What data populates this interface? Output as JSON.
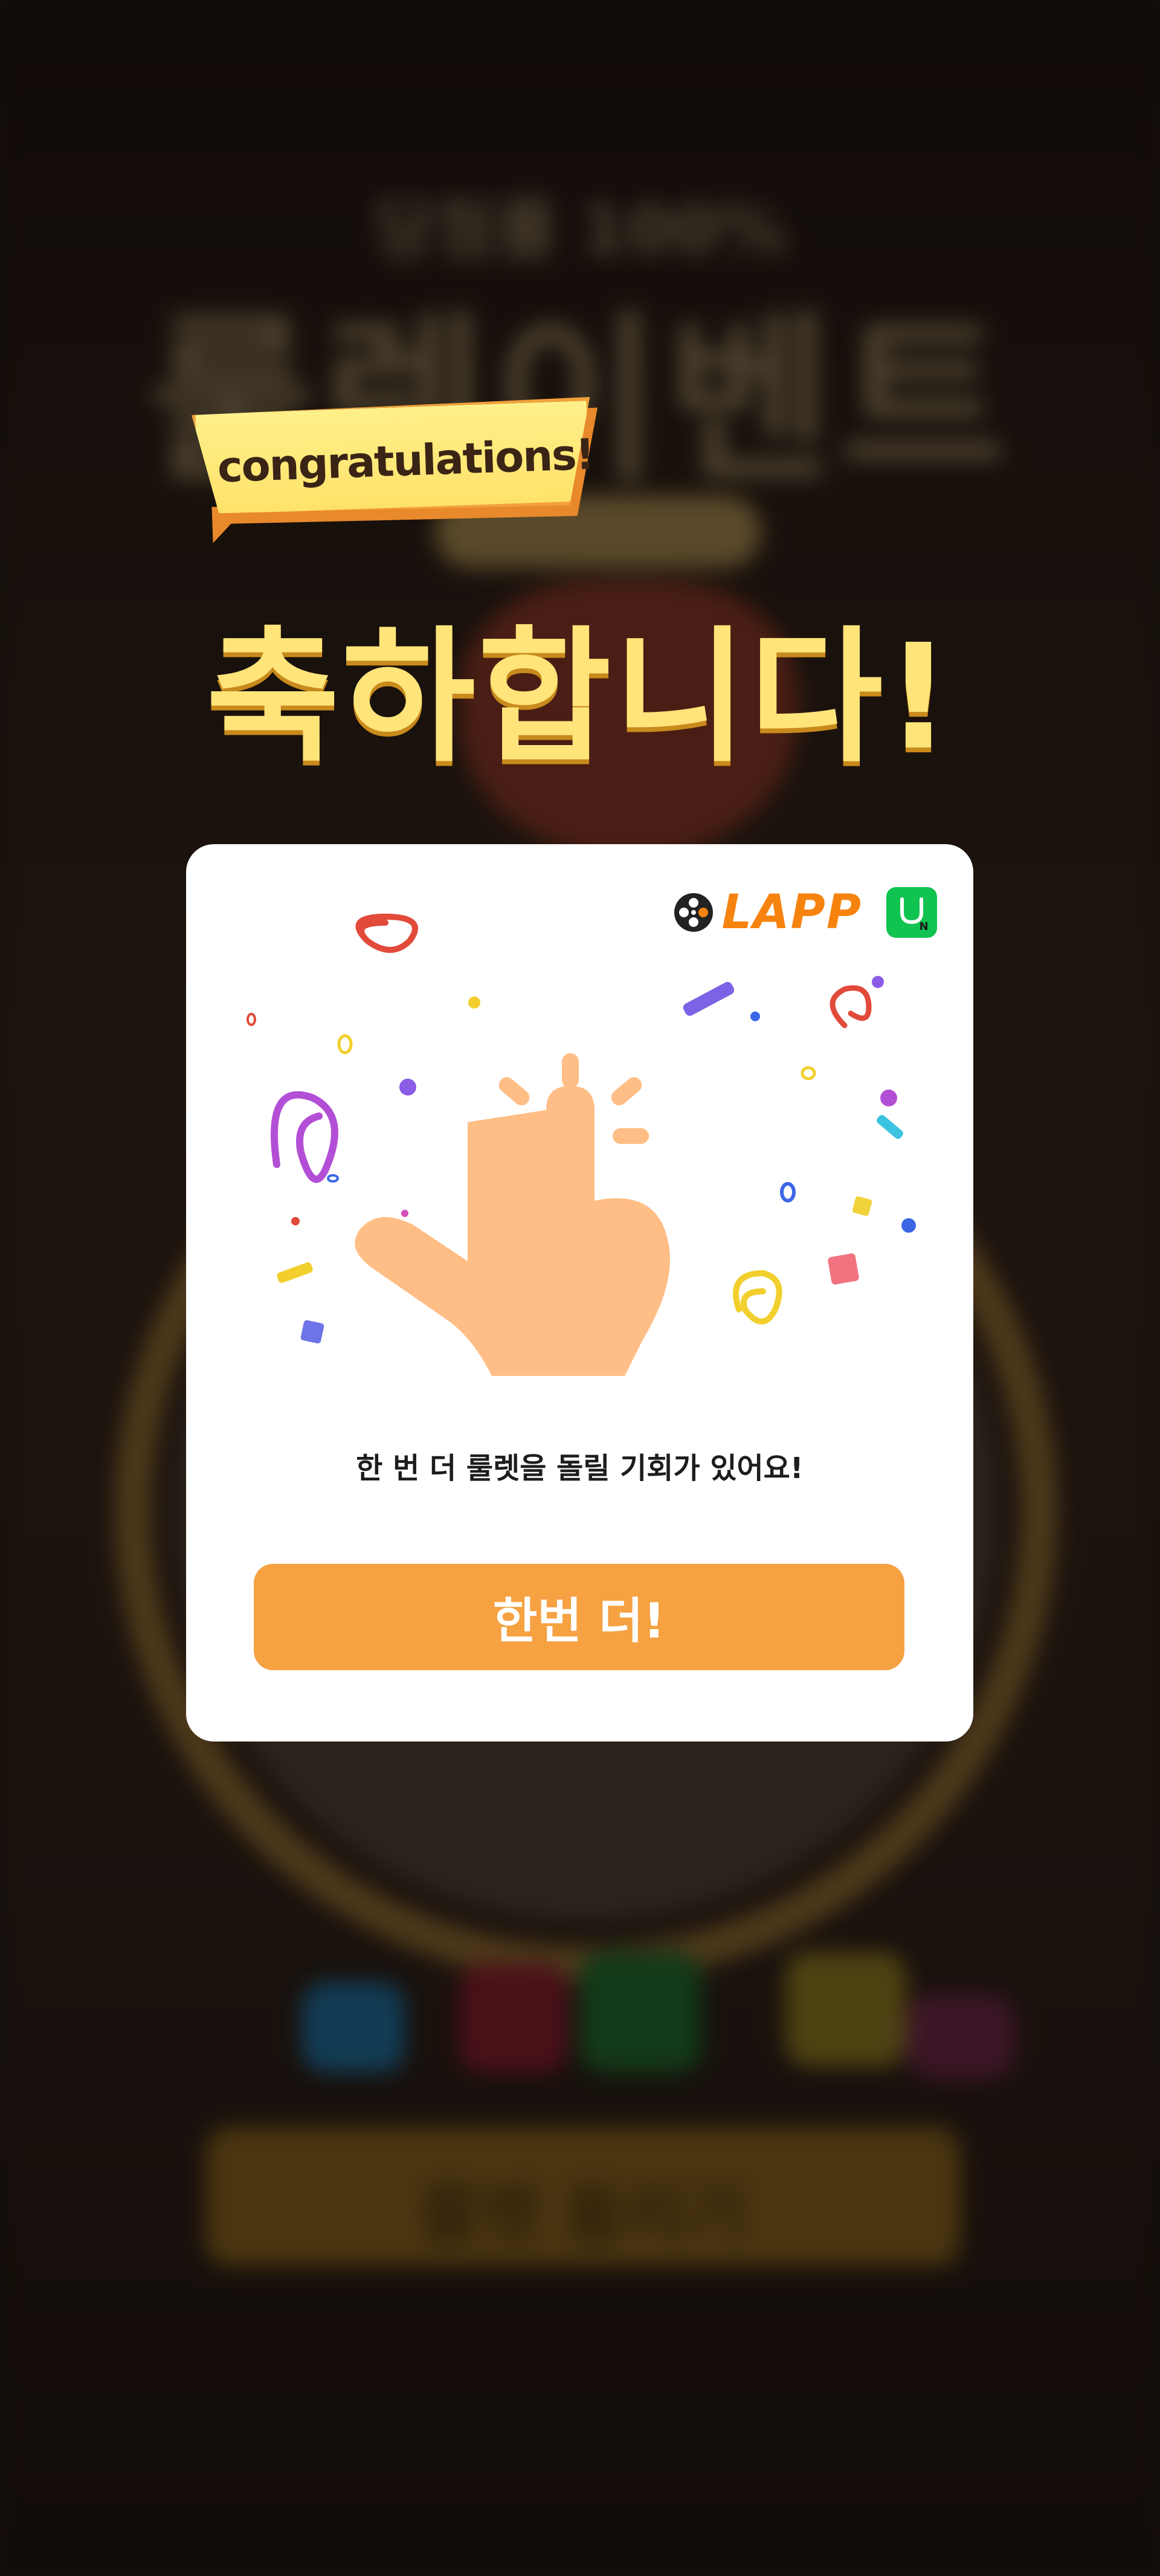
{
  "ribbon": {
    "text": "congratulations!"
  },
  "headline": {
    "text": "축하합니다!"
  },
  "brand": {
    "lapp_text": "LAPP",
    "lapp_icon": "film-reel-icon",
    "store_icon": "one-store-icon"
  },
  "modal": {
    "illustration": "tap-finger-confetti",
    "message": "한 번 더 룰렛을 돌릴 기회가 있어요!",
    "cta_label": "한번 더!"
  },
  "background": {
    "tagline": "당첨률 100%",
    "title": "룰렛이벤트",
    "button_label": "룰렛 돌리기"
  },
  "colors": {
    "accent": "#f6a142",
    "headline": "#ffe47a",
    "brand_orange": "#f7830f",
    "store_green": "#11c350",
    "overlay": "#140f0c"
  }
}
